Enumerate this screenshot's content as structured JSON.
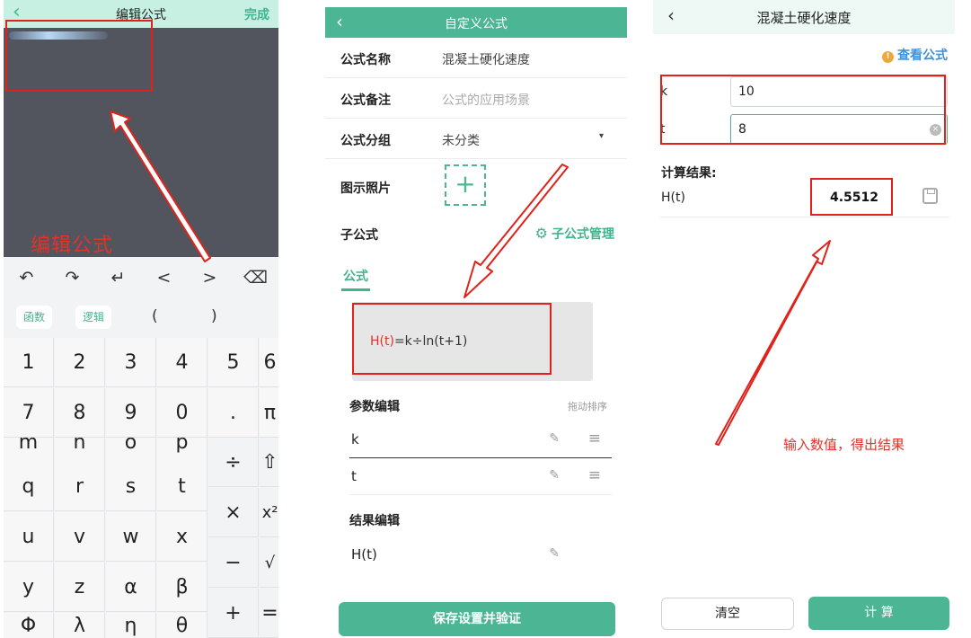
{
  "panel1": {
    "title": "编辑公式",
    "back_icon": "‹",
    "done": "完成",
    "editor_label": "编辑公式",
    "toolbar": [
      "↶",
      "↷",
      "↵",
      "<",
      ">",
      "⌫"
    ],
    "tags": {
      "func": "函数",
      "logic": "逻辑",
      "open": "(",
      "close": ")"
    },
    "keys": {
      "row1": [
        "1",
        "2",
        "3",
        "4",
        "5",
        "6"
      ],
      "row2": [
        "7",
        "8",
        "9",
        "0",
        ".",
        "π"
      ],
      "cut": [
        "m",
        "n",
        "o",
        "p"
      ],
      "row3": [
        "q",
        "r",
        "s",
        "t"
      ],
      "row4": [
        "u",
        "v",
        "w",
        "x"
      ],
      "row5": [
        "y",
        "z",
        "α",
        "β"
      ],
      "row6": [
        "Φ",
        "λ",
        "η",
        "θ"
      ],
      "side": [
        "÷",
        "⇧",
        "×",
        "x²",
        "−",
        "√",
        "+",
        "="
      ]
    }
  },
  "panel2": {
    "title": "自定义公式",
    "back_icon": "‹",
    "name_label": "公式名称",
    "name_value": "混凝土硬化速度",
    "note_label": "公式备注",
    "note_placeholder": "公式的应用场景",
    "group_label": "公式分组",
    "group_value": "未分类",
    "dropdown_icon": "▾",
    "photo_label": "图示照片",
    "add_icon": "+",
    "sub_label": "子公式",
    "gear_icon": "⚙",
    "sub_manage": "子公式管理",
    "tab_formula": "公式",
    "formula_lhs": "H(t)",
    "formula_rhs": "=k÷ln(t+1)",
    "param_title": "参数编辑",
    "sort_hint": "拖动排序",
    "edit_icon": "✎",
    "drag_icon": "≡",
    "params": [
      "k",
      "t"
    ],
    "result_title": "结果编辑",
    "result_item": "H(t)",
    "save_button": "保存设置并验证"
  },
  "panel3": {
    "title": "混凝土硬化速度",
    "back_icon": "‹",
    "info_icon": "!",
    "view_formula": "查看公式",
    "inputs": [
      {
        "label": "k",
        "value": "10"
      },
      {
        "label": "t",
        "value": "8"
      }
    ],
    "clear_icon": "×",
    "result_title": "计算结果:",
    "result_label": "H(t)",
    "result_value": "4.5512",
    "clear_button": "清空",
    "calc_button": "计 算",
    "callout": "输入数值，得出结果"
  }
}
